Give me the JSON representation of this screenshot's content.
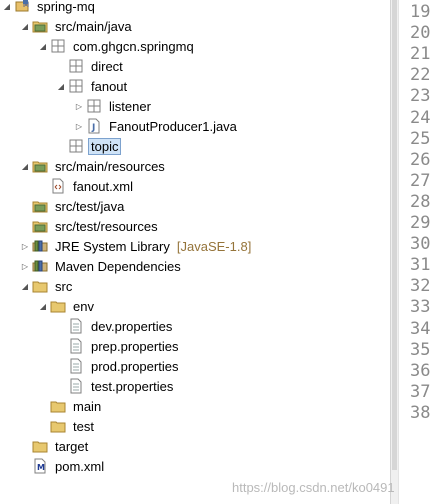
{
  "tree": [
    {
      "label": "spring-mq",
      "depth": 0,
      "twisty": "open",
      "icon": "maven-project-icon"
    },
    {
      "label": "src/main/java",
      "depth": 1,
      "twisty": "open",
      "icon": "source-folder-icon"
    },
    {
      "label": "com.ghgcn.springmq",
      "depth": 2,
      "twisty": "open",
      "icon": "package-icon"
    },
    {
      "label": "direct",
      "depth": 3,
      "twisty": "none",
      "icon": "package-icon"
    },
    {
      "label": "fanout",
      "depth": 3,
      "twisty": "open",
      "icon": "package-icon"
    },
    {
      "label": "listener",
      "depth": 4,
      "twisty": "closed",
      "icon": "package-icon"
    },
    {
      "label": "FanoutProducer1.java",
      "depth": 4,
      "twisty": "closed",
      "icon": "java-file-icon"
    },
    {
      "label": "topic",
      "depth": 3,
      "twisty": "none",
      "icon": "package-icon",
      "selected": true
    },
    {
      "label": "src/main/resources",
      "depth": 1,
      "twisty": "open",
      "icon": "source-folder-icon"
    },
    {
      "label": "fanout.xml",
      "depth": 2,
      "twisty": "none",
      "icon": "xml-file-icon"
    },
    {
      "label": "src/test/java",
      "depth": 1,
      "twisty": "none",
      "icon": "source-folder-icon"
    },
    {
      "label": "src/test/resources",
      "depth": 1,
      "twisty": "none",
      "icon": "source-folder-icon"
    },
    {
      "label": "JRE System Library",
      "deco": "[JavaSE-1.8]",
      "depth": 1,
      "twisty": "closed",
      "icon": "library-icon"
    },
    {
      "label": "Maven Dependencies",
      "depth": 1,
      "twisty": "closed",
      "icon": "library-icon"
    },
    {
      "label": "src",
      "depth": 1,
      "twisty": "open",
      "icon": "folder-icon"
    },
    {
      "label": "env",
      "depth": 2,
      "twisty": "open",
      "icon": "folder-icon"
    },
    {
      "label": "dev.properties",
      "depth": 3,
      "twisty": "none",
      "icon": "properties-file-icon"
    },
    {
      "label": "prep.properties",
      "depth": 3,
      "twisty": "none",
      "icon": "properties-file-icon"
    },
    {
      "label": "prod.properties",
      "depth": 3,
      "twisty": "none",
      "icon": "properties-file-icon"
    },
    {
      "label": "test.properties",
      "depth": 3,
      "twisty": "none",
      "icon": "properties-file-icon"
    },
    {
      "label": "main",
      "depth": 2,
      "twisty": "none",
      "icon": "folder-icon"
    },
    {
      "label": "test",
      "depth": 2,
      "twisty": "none",
      "icon": "folder-icon"
    },
    {
      "label": "target",
      "depth": 1,
      "twisty": "none",
      "icon": "folder-icon"
    },
    {
      "label": "pom.xml",
      "depth": 1,
      "twisty": "none",
      "icon": "maven-pom-icon"
    }
  ],
  "line_numbers": [
    "19",
    "20",
    "21",
    "22",
    "23",
    "24",
    "25",
    "26",
    "27",
    "28",
    "29",
    "30",
    "31",
    "32",
    "33",
    "34",
    "35",
    "36",
    "37",
    "38"
  ],
  "watermark": "https://blog.csdn.net/ko0491",
  "colors": {
    "selection": "#cfe3f7",
    "decoration": "#95743a",
    "line_number": "#8a8a8a"
  }
}
